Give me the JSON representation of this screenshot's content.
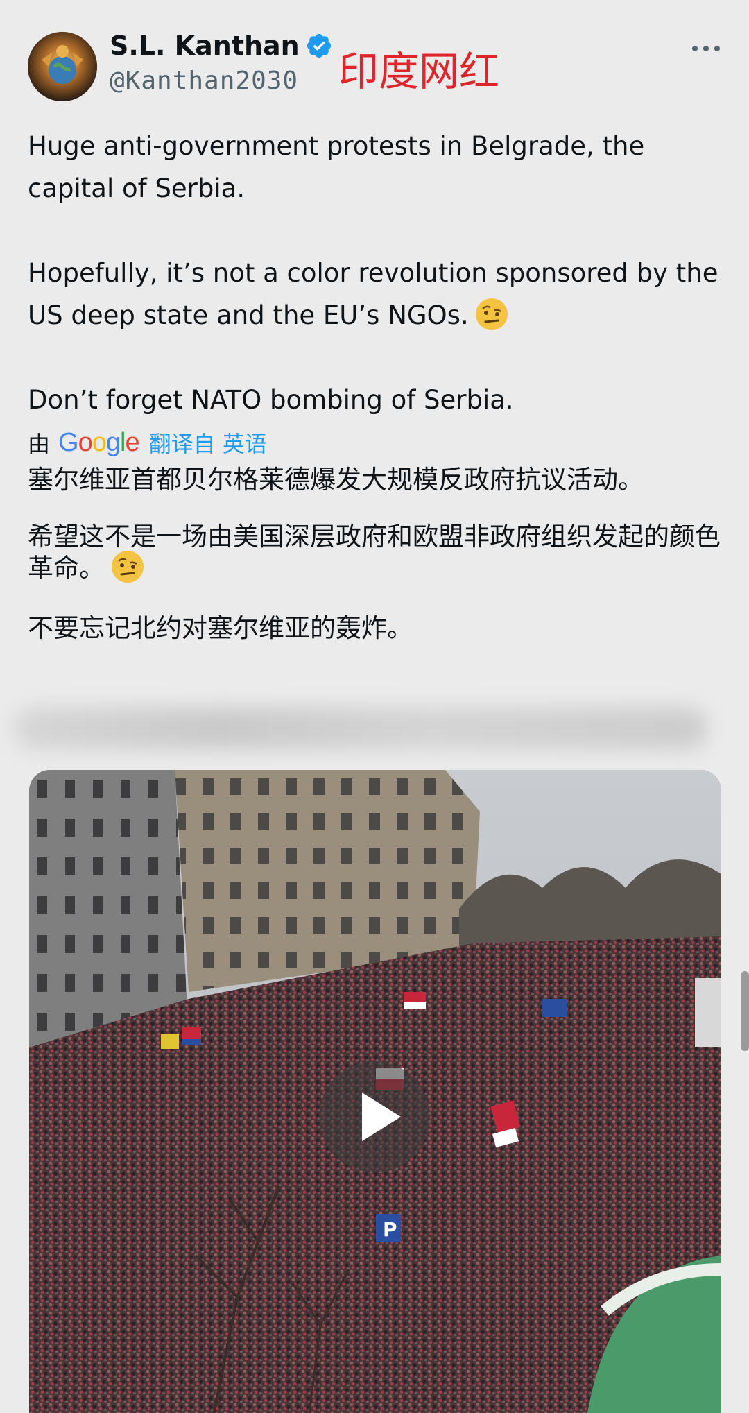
{
  "header": {
    "display_name": "S.L. Kanthan",
    "handle": "@Kanthan2030",
    "overlay_label": "印度网红"
  },
  "tweet": {
    "paragraphs": [
      "Huge anti-government protests in Belgrade, the capital of Serbia.",
      "Hopefully, it’s not a color revolution sponsored by the US deep state and the EU’s NGOs.",
      "Don’t forget NATO bombing of Serbia."
    ]
  },
  "translation": {
    "by_label": "由",
    "provider": "Google",
    "link_label": "翻译自 英语",
    "paragraphs": [
      "塞尔维亚首都贝尔格莱德爆发大规模反政府抗议活动。",
      "希望这不是一场由美国深层政府和欧盟非政府组织发起的颜色革命。",
      "不要忘记北约对塞尔维亚的轰炸。"
    ]
  },
  "media": {
    "type": "video",
    "icon": "play-icon"
  },
  "colors": {
    "link": "#1d9bf0",
    "verified": "#1d9bf0",
    "overlay_label": "#e0242a",
    "background": "#ebebeb"
  }
}
